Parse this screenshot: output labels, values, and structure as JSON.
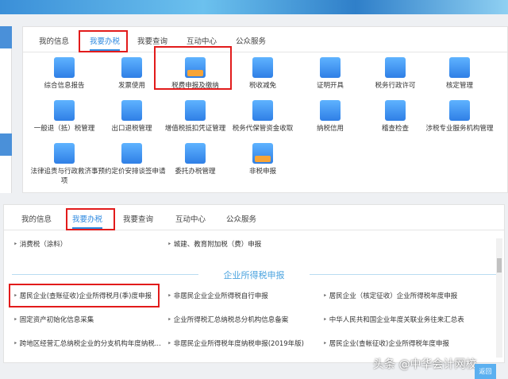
{
  "top_panel": {
    "tabs": [
      "我的信息",
      "我要办税",
      "我要查询",
      "互动中心",
      "公众服务"
    ],
    "icons": [
      {
        "label": "综合信息报告",
        "icon": "person-card-icon"
      },
      {
        "label": "发票使用",
        "icon": "users-icon"
      },
      {
        "label": "税费申报及缴纳",
        "icon": "tray-document-icon"
      },
      {
        "label": "税收减免",
        "icon": "clipboard-icon"
      },
      {
        "label": "证明开具",
        "icon": "certificate-icon"
      },
      {
        "label": "税务行政许可",
        "icon": "document-plus-icon"
      },
      {
        "label": "核定管理",
        "icon": "message-icon"
      },
      {
        "label": "一般退（抵）税管理",
        "icon": "stamp-document-icon"
      },
      {
        "label": "出口退税管理",
        "icon": "search-document-icon"
      },
      {
        "label": "增值税抵扣凭证管理",
        "icon": "document-stamp-icon"
      },
      {
        "label": "税务代保管资金收取",
        "icon": "money-transfer-icon"
      },
      {
        "label": "纳税信用",
        "icon": "building-icon"
      },
      {
        "label": "稽查检查",
        "icon": "cabinet-icon"
      },
      {
        "label": "涉税专业服务机构管理",
        "icon": "check-clipboard-icon"
      },
      {
        "label": "法律追责与行政救济事项",
        "icon": "yen-search-icon"
      },
      {
        "label": "预约定价安排谈签申请",
        "icon": "yen-search-icon"
      },
      {
        "label": "委托办税管理",
        "icon": "history-icon"
      },
      {
        "label": "非税申报",
        "icon": "tray-document-icon"
      }
    ]
  },
  "bottom_panel": {
    "tabs": [
      "我的信息",
      "我要办税",
      "我要查询",
      "互动中心",
      "公众服务"
    ],
    "top_items": [
      "消费税（涂料）",
      "城建、教育附加税（费）申报"
    ],
    "section_title": "企业所得税申报",
    "items": [
      "居民企业(查账征收)企业所得税月(季)度申报",
      "非居民企业企业所得税自行申报",
      "居民企业（核定征收）企业所得税年度申报",
      "固定资产初始化信息采集",
      "企业所得税汇总纳税总分机构信息备案",
      "中华人民共和国企业年度关联业务往来汇总表",
      "跨地区经营汇总纳税企业的分支机构年度纳税...",
      "非居民企业所得税年度纳税申报(2019年版)",
      "居民企业(查帐征收)企业所得税年度申报"
    ]
  },
  "watermark": "头条 @中华会计网校",
  "back_button": "返回"
}
